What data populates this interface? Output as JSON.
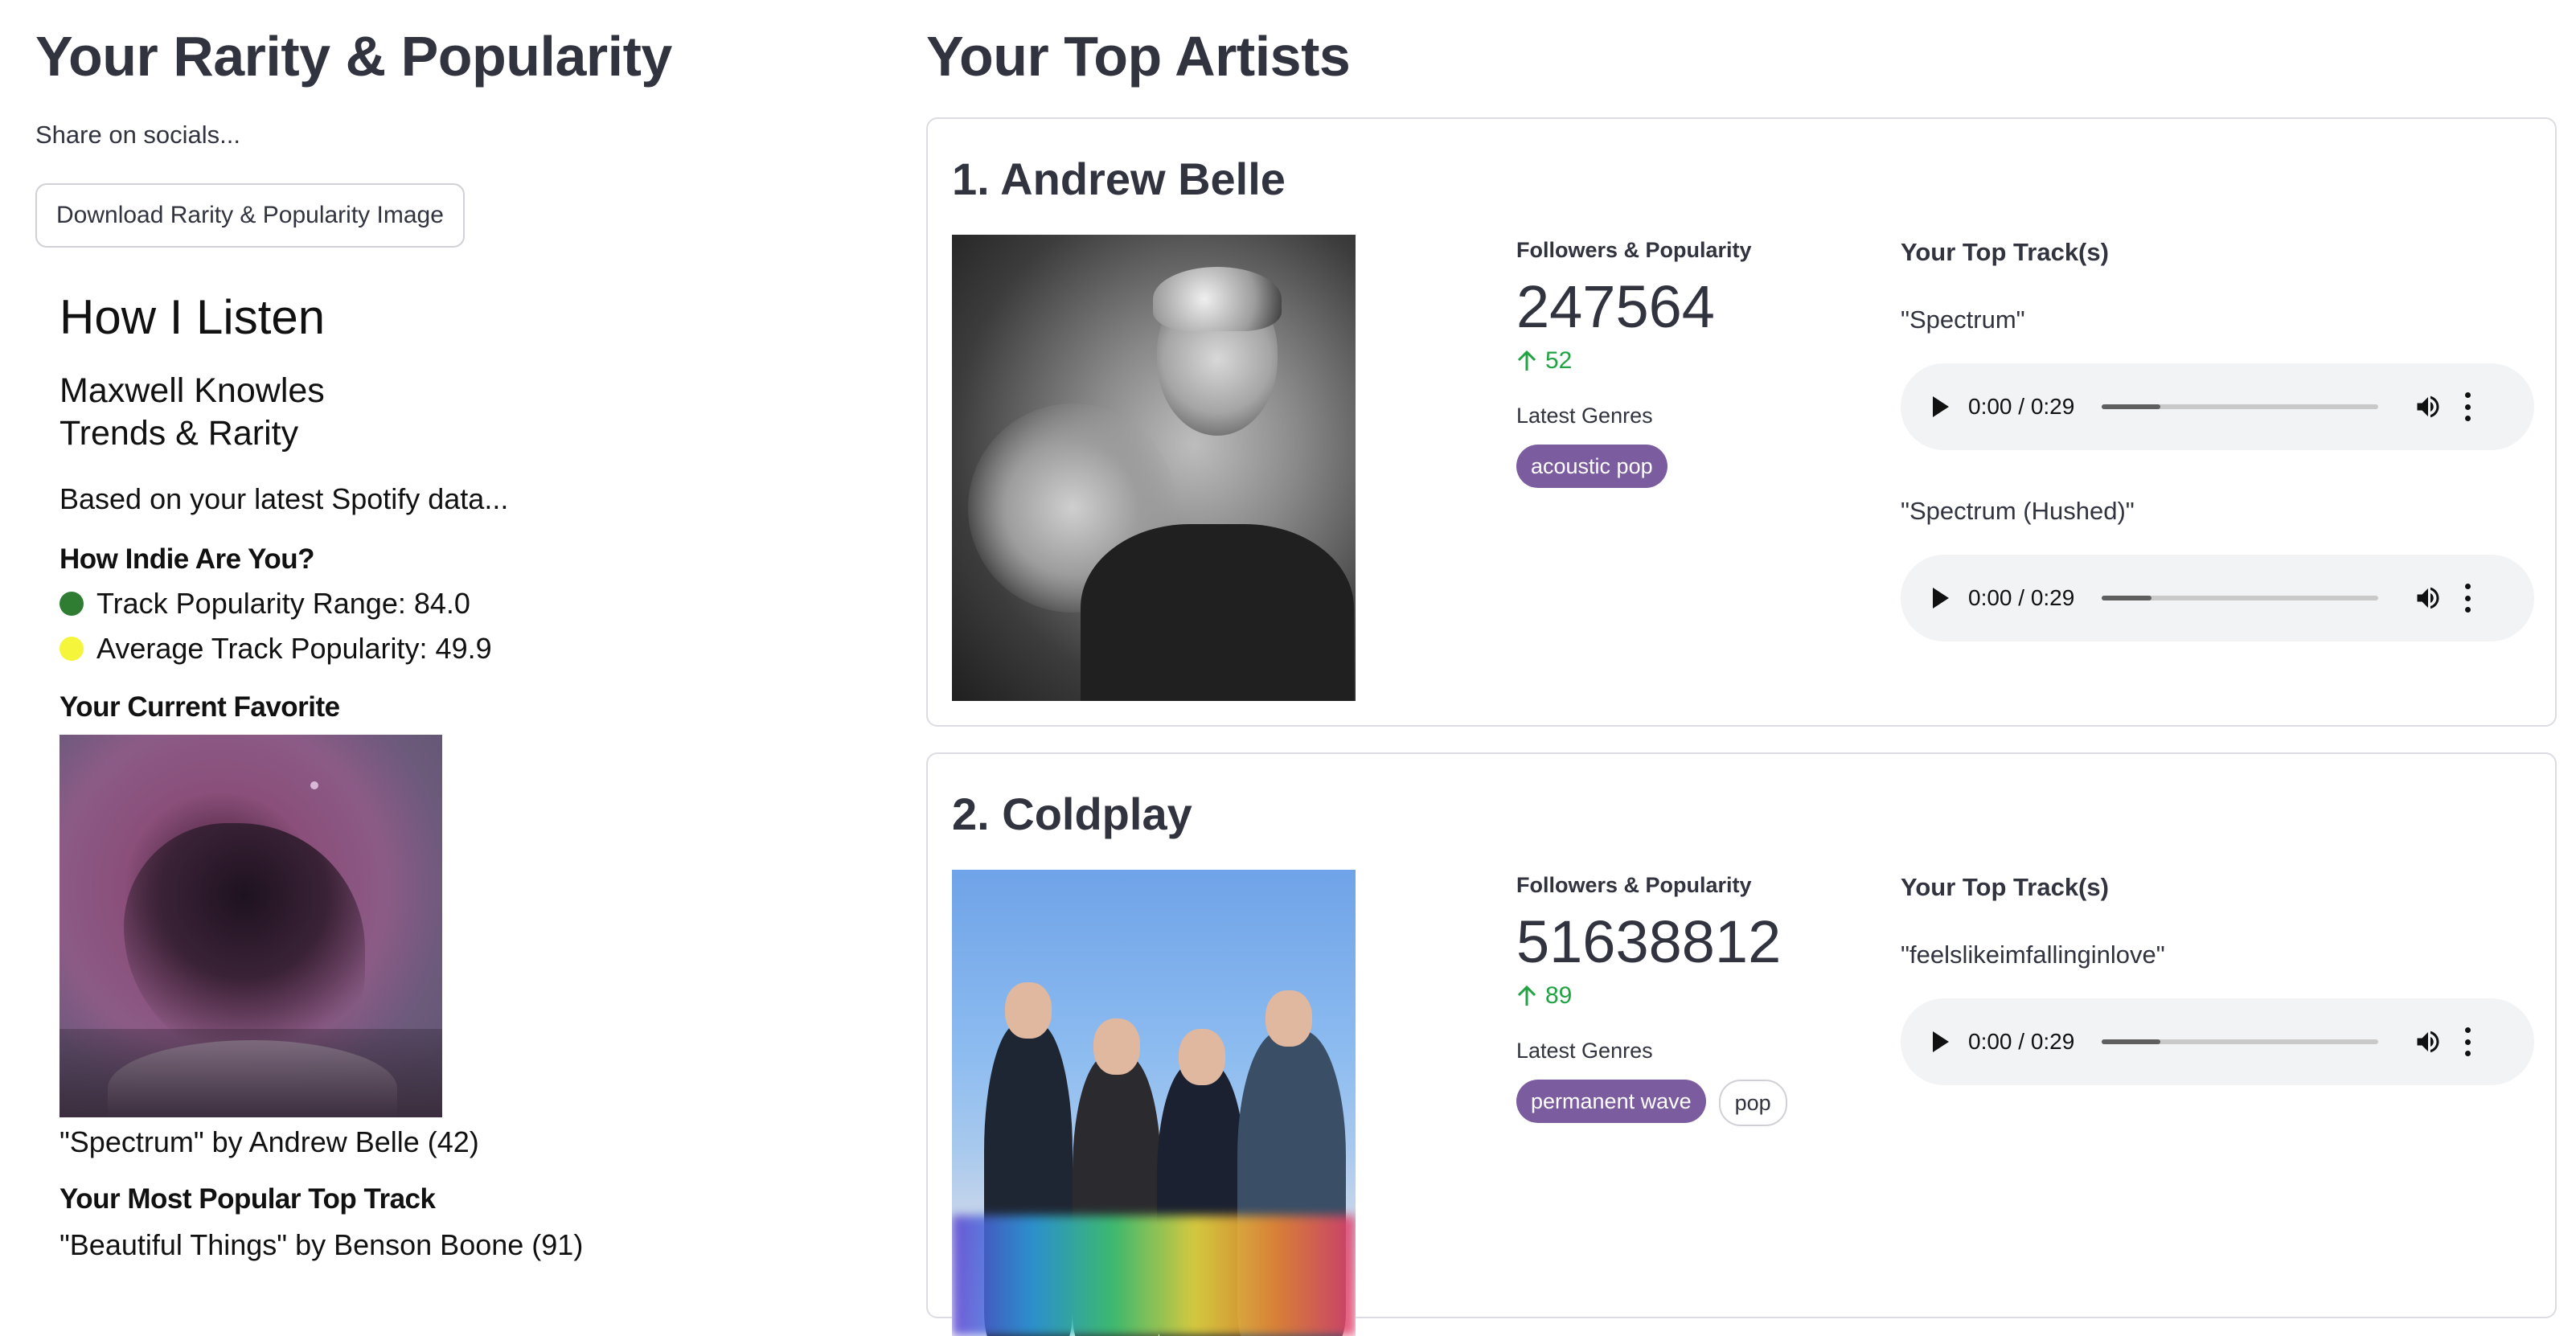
{
  "left": {
    "title": "Your Rarity & Popularity",
    "share_text": "Share on socials...",
    "download_button": "Download Rarity & Popularity Image",
    "card": {
      "title": "How I Listen",
      "name_line1": "Maxwell Knowles",
      "name_line2": "Trends & Rarity",
      "based_on": "Based on your latest Spotify data...",
      "indie_heading": "How Indie Are You?",
      "stat1": "Track Popularity Range: 84.0",
      "stat1_color": "#2e7d32",
      "stat2": "Average Track Popularity: 49.9",
      "stat2_color": "#f5f53b",
      "favorite_heading": "Your Current Favorite",
      "favorite_caption": "\"Spectrum\" by Andrew Belle (42)",
      "popular_heading": "Your Most Popular Top Track",
      "popular_caption": "\"Beautiful Things\" by Benson Boone (91)"
    }
  },
  "right": {
    "title": "Your Top Artists",
    "artists": [
      {
        "name": "1. Andrew Belle",
        "followers_label": "Followers & Popularity",
        "followers": "247564",
        "popularity": "52",
        "genres_label": "Latest Genres",
        "genres": [
          "acoustic pop"
        ],
        "tracks_label": "Your Top Track(s)",
        "tracks": [
          {
            "title": "\"Spectrum\"",
            "time": "0:00 / 0:29",
            "progress": 0.21
          },
          {
            "title": "\"Spectrum (Hushed)\"",
            "time": "0:00 / 0:29",
            "progress": 0.18
          }
        ]
      },
      {
        "name": "2. Coldplay",
        "followers_label": "Followers & Popularity",
        "followers": "51638812",
        "popularity": "89",
        "genres_label": "Latest Genres",
        "genres": [
          "permanent wave",
          "pop"
        ],
        "tracks_label": "Your Top Track(s)",
        "tracks": [
          {
            "title": "\"feelslikeimfallinginlove\"",
            "time": "0:00 / 0:29",
            "progress": 0.21
          }
        ]
      }
    ]
  },
  "colors": {
    "accent_tag": "#7b5c9e",
    "delta_green": "#21a344"
  }
}
